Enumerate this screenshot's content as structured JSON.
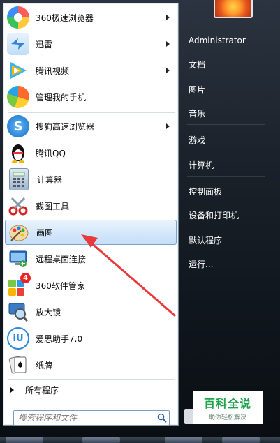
{
  "start_menu": {
    "programs": [
      {
        "label": "360极速浏览器",
        "has_submenu": true,
        "icon": "360-browser-icon"
      },
      {
        "label": "迅雷",
        "has_submenu": true,
        "icon": "xunlei-bird-icon"
      },
      {
        "label": "腾讯视频",
        "has_submenu": true,
        "icon": "tencent-video-play-icon"
      },
      {
        "label": "管理我的手机",
        "has_submenu": false,
        "icon": "phone-manager-icon"
      },
      {
        "label": "搜狗高速浏览器",
        "has_submenu": true,
        "icon": "sogou-browser-icon"
      },
      {
        "label": "腾讯QQ",
        "has_submenu": false,
        "icon": "qq-penguin-icon"
      },
      {
        "label": "计算器",
        "has_submenu": false,
        "icon": "calculator-icon"
      },
      {
        "label": "截图工具",
        "has_submenu": false,
        "icon": "snipping-scissors-icon"
      },
      {
        "label": "画图",
        "has_submenu": false,
        "icon": "paint-palette-icon",
        "highlighted": true
      },
      {
        "label": "远程桌面连接",
        "has_submenu": false,
        "icon": "remote-desktop-icon"
      },
      {
        "label": "360软件管家",
        "has_submenu": false,
        "icon": "360-software-manager-icon",
        "badge": "4"
      },
      {
        "label": "放大镜",
        "has_submenu": false,
        "icon": "magnifier-icon"
      },
      {
        "label": "爱思助手7.0",
        "has_submenu": false,
        "icon": "i4-assistant-icon"
      },
      {
        "label": "纸牌",
        "has_submenu": false,
        "icon": "solitaire-cards-icon"
      }
    ],
    "all_programs": "所有程序",
    "search_placeholder": "搜索程序和文件"
  },
  "right_column": {
    "items": [
      "Administrator",
      "文档",
      "图片",
      "音乐",
      "游戏",
      "计算机",
      "控制面板",
      "设备和打印机",
      "默认程序",
      "运行..."
    ]
  },
  "watermark": {
    "title": "百科全说",
    "subtitle": "助你轻松解决"
  },
  "colors": {
    "highlight_border": "#7da2ce",
    "annotation_arrow": "#e83a3a",
    "watermark_green": "#1fa24a"
  }
}
